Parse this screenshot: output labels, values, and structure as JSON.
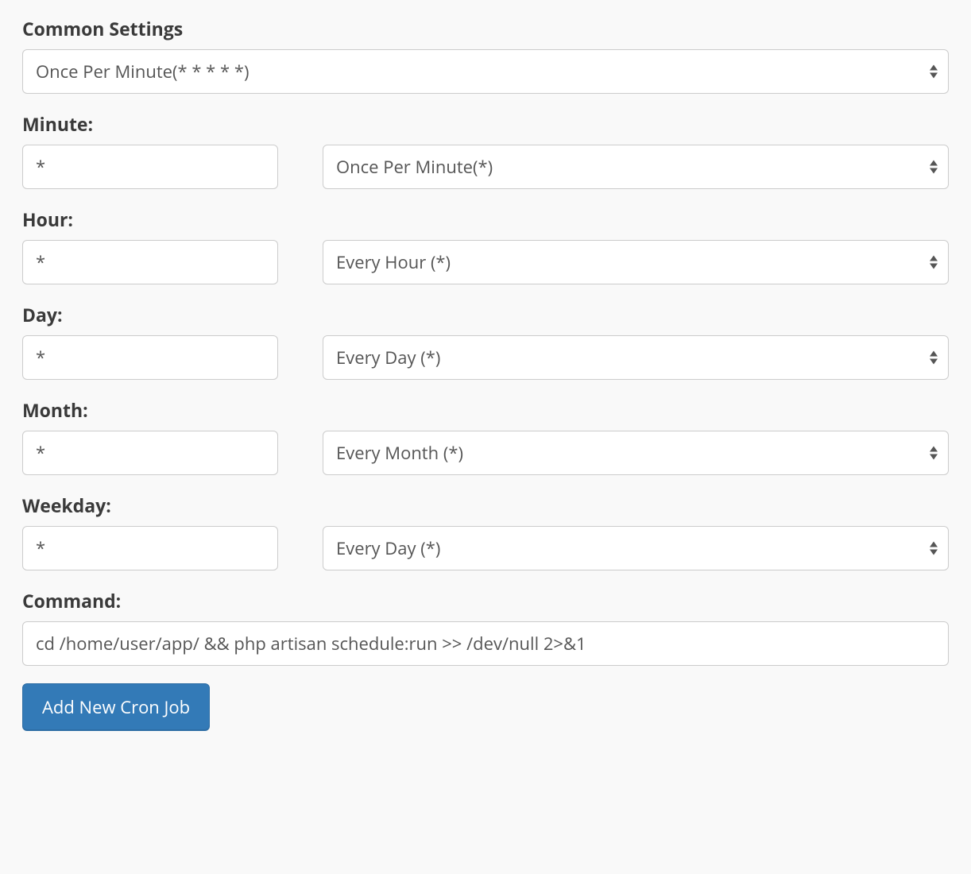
{
  "commonSettings": {
    "label": "Common Settings",
    "selected": "Once Per Minute(* * * * *)"
  },
  "fields": {
    "minute": {
      "label": "Minute:",
      "value": "*",
      "selectValue": "Once Per Minute(*)"
    },
    "hour": {
      "label": "Hour:",
      "value": "*",
      "selectValue": "Every Hour (*)"
    },
    "day": {
      "label": "Day:",
      "value": "*",
      "selectValue": "Every Day (*)"
    },
    "month": {
      "label": "Month:",
      "value": "*",
      "selectValue": "Every Month (*)"
    },
    "weekday": {
      "label": "Weekday:",
      "value": "*",
      "selectValue": "Every Day (*)"
    }
  },
  "command": {
    "label": "Command:",
    "value": "cd /home/user/app/ && php artisan schedule:run >> /dev/null 2>&1"
  },
  "submitButton": {
    "label": "Add New Cron Job"
  }
}
